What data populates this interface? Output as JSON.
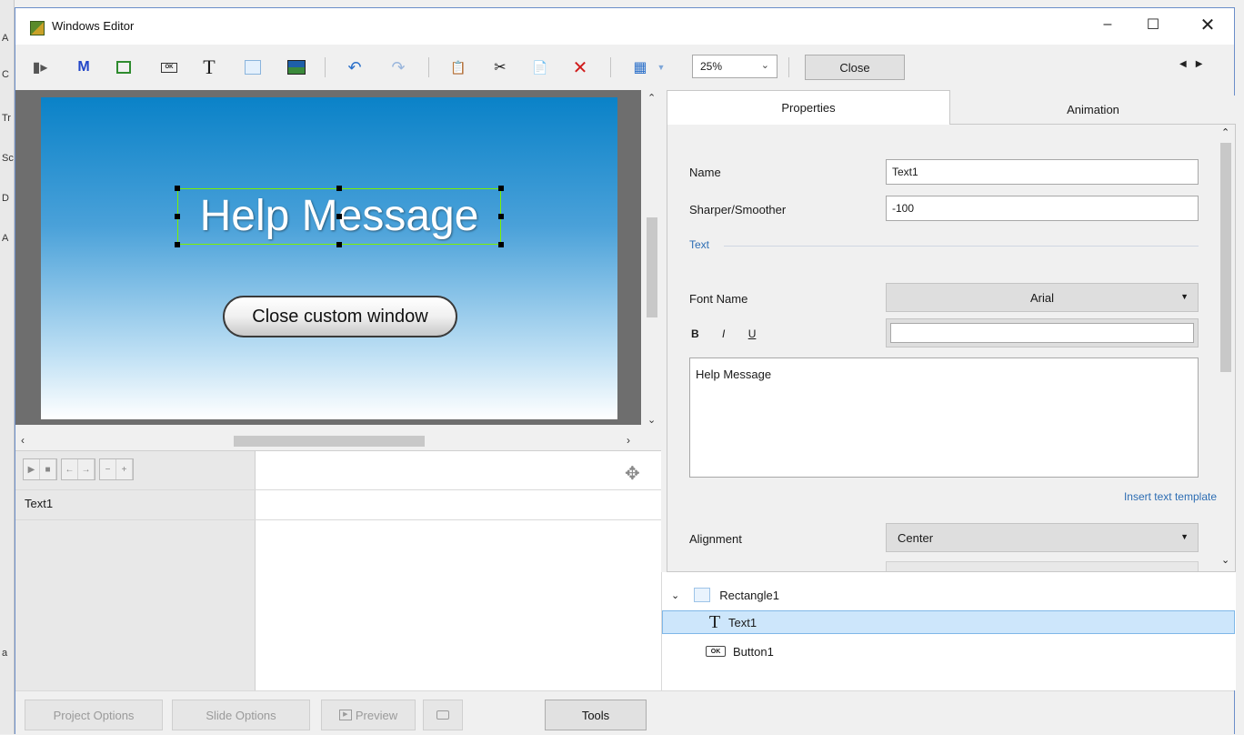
{
  "window": {
    "title": "Windows Editor"
  },
  "background_letters": [
    "A",
    "C",
    "Tr",
    "Sc",
    "D",
    "A",
    "a"
  ],
  "toolbar": {
    "zoom_value": "25%",
    "close_label": "Close"
  },
  "slide": {
    "text": "Help Message",
    "button_label": "Close custom window"
  },
  "timeline": {
    "row_label": "Text1"
  },
  "tabs": {
    "properties": "Properties",
    "animation": "Animation"
  },
  "properties": {
    "name_label": "Name",
    "name_value": "Text1",
    "smooth_label": "Sharper/Smoother",
    "smooth_value": "-100",
    "text_section": "Text",
    "font_label": "Font Name",
    "font_value": "Arial",
    "bold": "B",
    "italic": "I",
    "underline": "U",
    "text_content": "Help Message",
    "insert_template": "Insert text template",
    "alignment_label": "Alignment",
    "alignment_value": "Center"
  },
  "tree": {
    "items": [
      {
        "label": "Rectangle1"
      },
      {
        "label": "Text1"
      },
      {
        "label": "Button1"
      }
    ]
  },
  "footer": {
    "project_options": "Project Options",
    "slide_options": "Slide Options",
    "preview": "Preview",
    "tools": "Tools"
  }
}
